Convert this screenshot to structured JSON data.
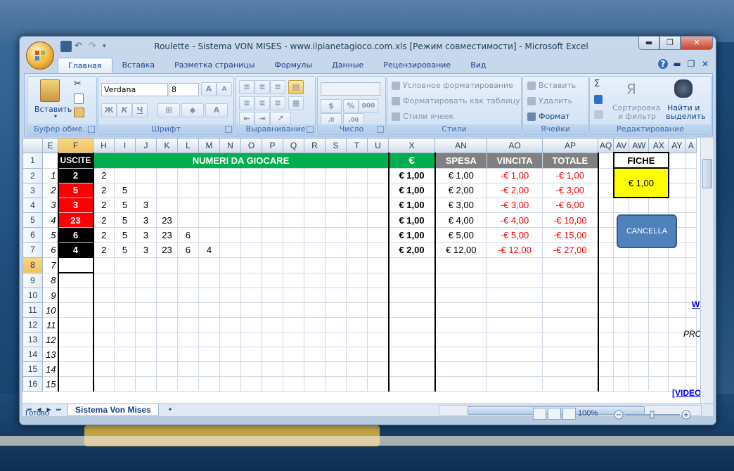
{
  "window": {
    "title": "Roulette - Sistema VON MISES - www.ilpianetagioco.com.xls  [Режим совместимости] - Microsoft Excel",
    "minimize": "▬",
    "maximize": "❐",
    "close": "✕"
  },
  "tabs": [
    "Главная",
    "Вставка",
    "Разметка страницы",
    "Формулы",
    "Данные",
    "Рецензирование",
    "Вид"
  ],
  "ribbon": {
    "clipboard": {
      "paste": "Вставить",
      "label": "Буфер обме..."
    },
    "font": {
      "name": "Verdana",
      "size": "8",
      "label": "Шрифт",
      "bold": "Ж",
      "italic": "К",
      "underline": "Ч"
    },
    "alignment": {
      "label": "Выравнивание"
    },
    "number": {
      "label": "Число",
      "percent": "%",
      "thousands": "000"
    },
    "styles": {
      "cond": "Условное форматирование",
      "table": "Форматировать как таблицу",
      "cell": "Стили ячеек",
      "label": "Стили"
    },
    "cells": {
      "insert": "Вставить",
      "delete": "Удалить",
      "format": "Формат",
      "label": "Ячейки"
    },
    "editing": {
      "sort": "Сортировка",
      "sort2": "и фильтр",
      "find": "Найти и",
      "find2": "выделить",
      "label": "Редактирование"
    }
  },
  "columns": [
    "E",
    "F",
    "H",
    "I",
    "J",
    "K",
    "L",
    "M",
    "N",
    "O",
    "P",
    "Q",
    "R",
    "S",
    "T",
    "U",
    "X",
    "AN",
    "AO",
    "AP",
    "AQ",
    "AV",
    "AW",
    "AX",
    "AY",
    "A"
  ],
  "header_row": {
    "uscite": "USCITE",
    "numeri": "NUMERI DA GIOCARE",
    "euro": "€",
    "spesa": "SPESA",
    "vincita": "VINCITA",
    "totale": "TOTALE",
    "fiche": "FICHE"
  },
  "rows": [
    {
      "row": "1"
    },
    {
      "row": "2",
      "idx": "1",
      "uscita": "2",
      "uscita_color": "black",
      "nums": [
        "2",
        "",
        "",
        "",
        "",
        ""
      ],
      "x": "€ 1,00",
      "spesa": "€ 1,00",
      "vincita": "-€ 1,00",
      "totale": "-€ 1,00",
      "fiche": "€ 1,00"
    },
    {
      "row": "3",
      "idx": "2",
      "uscita": "5",
      "uscita_color": "red",
      "nums": [
        "2",
        "5",
        "",
        "",
        "",
        ""
      ],
      "x": "€ 1,00",
      "spesa": "€ 2,00",
      "vincita": "-€ 2,00",
      "totale": "-€ 3,00"
    },
    {
      "row": "4",
      "idx": "3",
      "uscita": "3",
      "uscita_color": "red",
      "nums": [
        "2",
        "5",
        "3",
        "",
        "",
        ""
      ],
      "x": "€ 1,00",
      "spesa": "€ 3,00",
      "vincita": "-€ 3,00",
      "totale": "-€ 6,00"
    },
    {
      "row": "5",
      "idx": "4",
      "uscita": "23",
      "uscita_color": "red",
      "nums": [
        "2",
        "5",
        "3",
        "23",
        "",
        ""
      ],
      "x": "€ 1,00",
      "spesa": "€ 4,00",
      "vincita": "-€ 4,00",
      "totale": "-€ 10,00"
    },
    {
      "row": "6",
      "idx": "5",
      "uscita": "6",
      "uscita_color": "black",
      "nums": [
        "2",
        "5",
        "3",
        "23",
        "6",
        ""
      ],
      "x": "€ 1,00",
      "spesa": "€ 5,00",
      "vincita": "-€ 5,00",
      "totale": "-€ 15,00"
    },
    {
      "row": "7",
      "idx": "6",
      "uscita": "4",
      "uscita_color": "black",
      "nums": [
        "2",
        "5",
        "3",
        "23",
        "6",
        "4"
      ],
      "x": "€ 2,00",
      "spesa": "€ 12,00",
      "vincita": "-€ 12,00",
      "totale": "-€ 27,00"
    },
    {
      "row": "8",
      "idx": "7"
    },
    {
      "row": "9",
      "idx": "8"
    },
    {
      "row": "10",
      "idx": "9"
    },
    {
      "row": "11",
      "idx": "10"
    },
    {
      "row": "12",
      "idx": "11"
    },
    {
      "row": "13",
      "idx": "12"
    },
    {
      "row": "14",
      "idx": "13"
    },
    {
      "row": "15",
      "idx": "14"
    },
    {
      "row": "16",
      "idx": "15"
    }
  ],
  "buttons": {
    "cancella": "CANCELLA"
  },
  "side": {
    "link1": "W",
    "pro": "PRO",
    "video": "[VIDEO"
  },
  "sheet_tab": "Sistema Von Mises",
  "status": {
    "ready": "Готово",
    "zoom": "100%"
  },
  "colors": {
    "green": "#00b050",
    "red": "#ff0000",
    "yellow": "#ffff00",
    "gray": "#808080",
    "button": "#4f81bd"
  }
}
